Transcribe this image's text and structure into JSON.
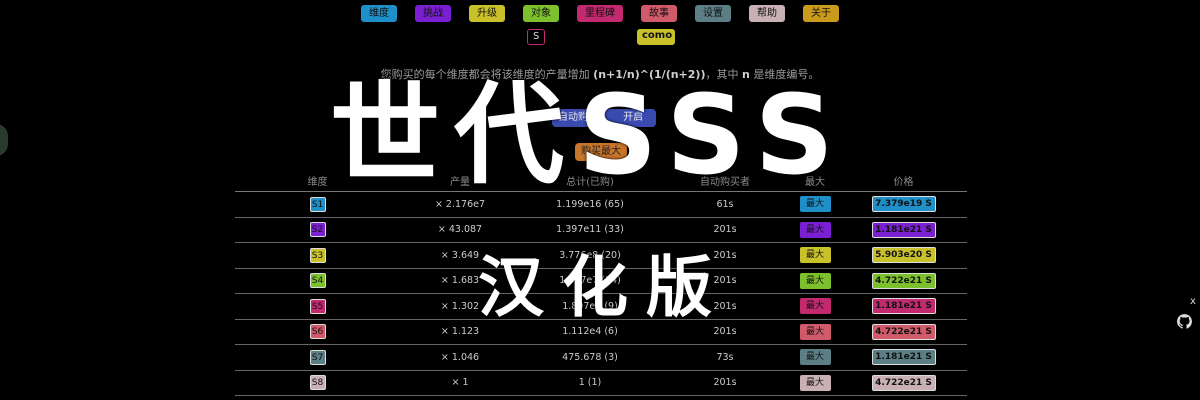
{
  "nav": {
    "tabs": [
      {
        "label": "维度",
        "color": "#1e8fc8"
      },
      {
        "label": "挑战",
        "color": "#7a1fd1"
      },
      {
        "label": "升级",
        "color": "#c9c12a"
      },
      {
        "label": "对象",
        "color": "#7cc02d"
      },
      {
        "label": "里程碑",
        "color": "#c2296e"
      },
      {
        "label": "故事",
        "color": "#d05a6a"
      },
      {
        "label": "设置",
        "color": "#5c7f86"
      },
      {
        "label": "帮助",
        "color": "#c8b0b4"
      },
      {
        "label": "关于",
        "color": "#c99a1b"
      }
    ],
    "subtabs": [
      {
        "label": "S",
        "color": "#c2296e"
      },
      {
        "label": "como",
        "color": "#c9c12a"
      }
    ]
  },
  "info": {
    "prefix": "您购买的每个维度都会将该维度的产量增加 ",
    "formula": "(n+1/n)^(1/(n+2))",
    "middle": "，其中 ",
    "n": "n",
    "suffix": " 是维度编号。"
  },
  "actions": {
    "autobuy": "自动购买",
    "autobuy_state": "开启",
    "buy_max": "购买最大"
  },
  "table": {
    "headers": [
      "维度",
      "产量",
      "总计(已购)",
      "自动购买者",
      "最大",
      "价格"
    ],
    "max_label": "最大",
    "rows": [
      {
        "dim": "S1",
        "mult": "× 2.176e7",
        "total": "1.199e16 (65)",
        "auto": "61s",
        "price": "7.379e19 S",
        "color": "#1e8fc8"
      },
      {
        "dim": "S2",
        "mult": "× 43.087",
        "total": "1.397e11 (33)",
        "auto": "201s",
        "price": "1.181e21 S",
        "color": "#7a1fd1"
      },
      {
        "dim": "S3",
        "mult": "× 3.649",
        "total": "3.776e8 (20)",
        "auto": "201s",
        "price": "5.903e20 S",
        "color": "#c9c12a"
      },
      {
        "dim": "S4",
        "mult": "× 1.683",
        "total": "1.847e7 (14)",
        "auto": "201s",
        "price": "4.722e21 S",
        "color": "#7cc02d"
      },
      {
        "dim": "S5",
        "mult": "× 1.302",
        "total": "1.897e5 (9)",
        "auto": "201s",
        "price": "1.181e21 S",
        "color": "#c2296e"
      },
      {
        "dim": "S6",
        "mult": "× 1.123",
        "total": "1.112e4 (6)",
        "auto": "201s",
        "price": "4.722e21 S",
        "color": "#d05a6a"
      },
      {
        "dim": "S7",
        "mult": "× 1.046",
        "total": "475.678 (3)",
        "auto": "73s",
        "price": "1.181e21 S",
        "color": "#5c7f86"
      },
      {
        "dim": "S8",
        "mult": "× 1",
        "total": "1 (1)",
        "auto": "201s",
        "price": "4.722e21 S",
        "color": "#c8b0b4"
      }
    ]
  },
  "overlay": {
    "title": "世代SSS",
    "subtitle": "汉化版"
  },
  "widgets": {
    "close": "x"
  }
}
